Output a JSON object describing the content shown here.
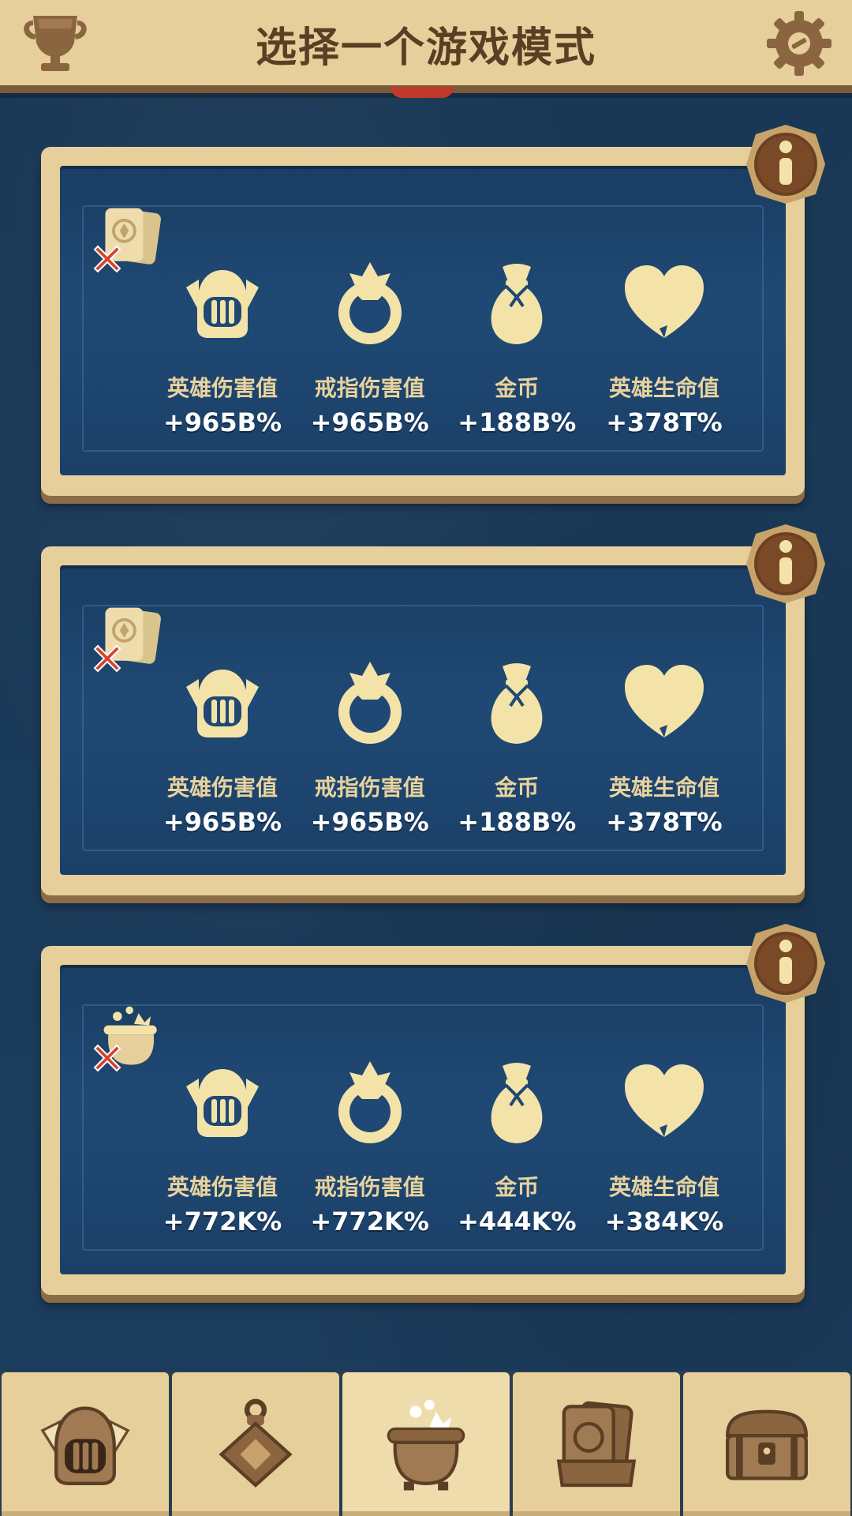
{
  "header": {
    "title": "选择一个游戏模式",
    "left_icon": "trophy-icon",
    "right_icon": "gear-icon"
  },
  "colors": {
    "header_bg": "#e6cf9a",
    "title": "#5b3f25",
    "card_frame": "#e6cf9a",
    "card_inner": "#1f4974",
    "label": "#e8d39e",
    "value": "#ffffff",
    "icon": "#f3e3a8",
    "cross": "#d8422c"
  },
  "modes": [
    {
      "mode_icon": "cards-icon",
      "stats": [
        {
          "icon": "helmet-icon",
          "label": "英雄伤害值",
          "value": "+965B%"
        },
        {
          "icon": "ring-icon",
          "label": "戒指伤害值",
          "value": "+965B%"
        },
        {
          "icon": "money-bag-icon",
          "label": "金币",
          "value": "+188B%"
        },
        {
          "icon": "heart-icon",
          "label": "英雄生命值",
          "value": "+378T%"
        }
      ]
    },
    {
      "mode_icon": "cards-icon",
      "stats": [
        {
          "icon": "helmet-icon",
          "label": "英雄伤害值",
          "value": "+965B%"
        },
        {
          "icon": "ring-icon",
          "label": "戒指伤害值",
          "value": "+965B%"
        },
        {
          "icon": "money-bag-icon",
          "label": "金币",
          "value": "+188B%"
        },
        {
          "icon": "heart-icon",
          "label": "英雄生命值",
          "value": "+378T%"
        }
      ]
    },
    {
      "mode_icon": "cauldron-icon",
      "stats": [
        {
          "icon": "helmet-icon",
          "label": "英雄伤害值",
          "value": "+772K%"
        },
        {
          "icon": "ring-icon",
          "label": "戒指伤害值",
          "value": "+772K%"
        },
        {
          "icon": "money-bag-icon",
          "label": "金币",
          "value": "+444K%"
        },
        {
          "icon": "heart-icon",
          "label": "英雄生命值",
          "value": "+384K%"
        }
      ]
    }
  ],
  "bottom_nav": [
    {
      "icon": "helmet-icon"
    },
    {
      "icon": "amulet-icon"
    },
    {
      "icon": "cauldron-icon",
      "active": true
    },
    {
      "icon": "cards-icon"
    },
    {
      "icon": "chest-icon"
    }
  ]
}
